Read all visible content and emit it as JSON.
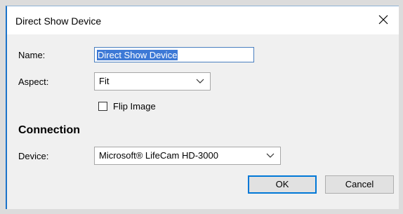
{
  "window": {
    "title": "Direct Show Device"
  },
  "form": {
    "name_label": "Name:",
    "name_value": "Direct Show Device",
    "aspect_label": "Aspect:",
    "aspect_value": "Fit",
    "flip_label": "Flip Image",
    "flip_checked": false
  },
  "connection": {
    "heading": "Connection",
    "device_label": "Device:",
    "device_value": "Microsoft® LifeCam HD-3000"
  },
  "buttons": {
    "ok": "OK",
    "cancel": "Cancel"
  },
  "icons": {
    "close": "close-icon",
    "dropdown": "chevron-down-icon"
  },
  "colors": {
    "selection": "#3d79d6",
    "focus_border": "#0078d7",
    "accent_border": "#1a73c9"
  }
}
